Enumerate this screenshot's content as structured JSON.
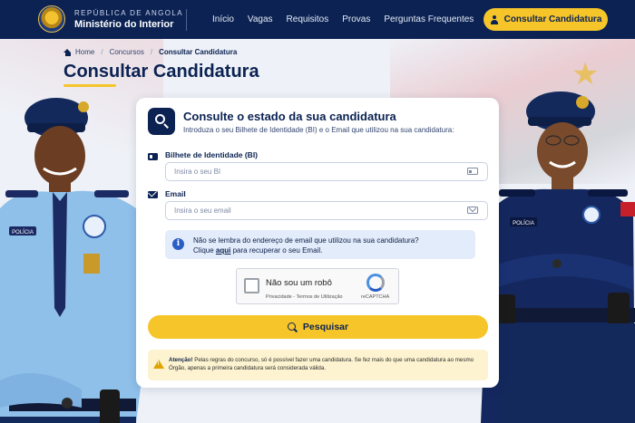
{
  "header": {
    "brand_top": "REPÚBLICA DE ANGOLA",
    "brand_main": "Ministério do Interior",
    "nav": [
      "Início",
      "Vagas",
      "Requisitos",
      "Provas",
      "Perguntas Frequentes"
    ],
    "cta_label": "Consultar Candidatura"
  },
  "breadcrumb": {
    "home": "Home",
    "section": "Concursos",
    "current": "Consultar Candidatura"
  },
  "page_title": "Consultar Candidatura",
  "card": {
    "title": "Consulte o estado da sua candidatura",
    "subtitle": "Introduza o seu Bilhete de Identidade (BI) e o Email que utilizou na sua candidatura:",
    "bi_label": "Bilhete de Identidade (BI)",
    "bi_placeholder": "Insira o seu BI",
    "bi_value": "",
    "email_label": "Email",
    "email_placeholder": "Insira o seu email",
    "email_value": "",
    "info_line1": "Não se lembra do endereço de email que utilizou na sua candidatura?",
    "info_click": "Clique",
    "info_link": "aqui",
    "info_rest": "para recuperar o seu Email.",
    "captcha_label": "Não sou um robô",
    "captcha_links": "Privacidade - Termos de Utilização",
    "captcha_brand": "reCAPTCHA",
    "search_button": "Pesquisar",
    "alert_bold": "Atenção!",
    "alert_text": "Pelas regras do concurso, só é possível fazer uma candidatura. Se fez mais do que uma candidatura ao mesmo Órgão, apenas a primeira candidatura será considerada válida."
  },
  "officers": {
    "left_badge": "POLÍCIA",
    "right_badge": "POLÍCIA"
  },
  "colors": {
    "navy": "#0b2252",
    "accent_yellow": "#f6c52a",
    "info_bg": "#e3ecfa",
    "alert_bg": "#fdf3d0"
  },
  "icons": [
    "emblem-icon",
    "user-icon",
    "home-icon",
    "search-icon",
    "id-card-icon",
    "mail-icon",
    "info-icon",
    "recaptcha-icon",
    "warning-icon"
  ]
}
